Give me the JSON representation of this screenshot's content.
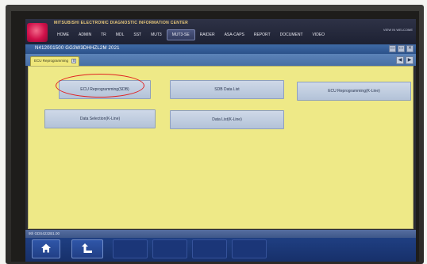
{
  "app": {
    "title": "MITSUBISHI ELECTRONIC DIAGNOSTIC INFORMATION CENTER",
    "header_right": "VIEW IN   WELCOME"
  },
  "nav": {
    "items": [
      {
        "label": "HOME",
        "active": false
      },
      {
        "label": "ADMIN",
        "active": false
      },
      {
        "label": "TR",
        "active": false
      },
      {
        "label": "MDL",
        "active": false
      },
      {
        "label": "SST",
        "active": false
      },
      {
        "label": "MUT3",
        "active": false
      },
      {
        "label": "MUT3-SE",
        "active": true
      },
      {
        "label": "RAIDER",
        "active": false
      },
      {
        "label": "ASA-CAPS",
        "active": false
      },
      {
        "label": "REPORT",
        "active": false
      },
      {
        "label": "DOCUMENT",
        "active": false
      },
      {
        "label": "VIDEO",
        "active": false
      }
    ]
  },
  "vehicle": {
    "info": "N412001500   GG3W3DHHZL2M 2021"
  },
  "window_buttons": [
    "▭",
    "▭",
    "✕"
  ],
  "tab": {
    "label": "ECU Reprogramming",
    "close": "x",
    "nav_prev": "◀",
    "nav_next": "▶"
  },
  "functions": {
    "ecu_reprogramming_sdb": "ECU Reprogramming(SDB)",
    "sdb_data_list": "SDB Data List",
    "ecu_reprogramming_kline": "ECU Reprogramming(K-Line)",
    "data_selection_kline": "Data Selection(K-Line)",
    "data_list_kline": "Data List(K-Line)"
  },
  "status": {
    "text": "9th GDS4232B1.00"
  },
  "toolbar": {
    "home_icon": "home-icon",
    "back_icon": "return-arrow-icon"
  },
  "colors": {
    "content_bg": "#eee987",
    "highlight": "#e02222",
    "toolbar_bg": "#1f3f82"
  }
}
